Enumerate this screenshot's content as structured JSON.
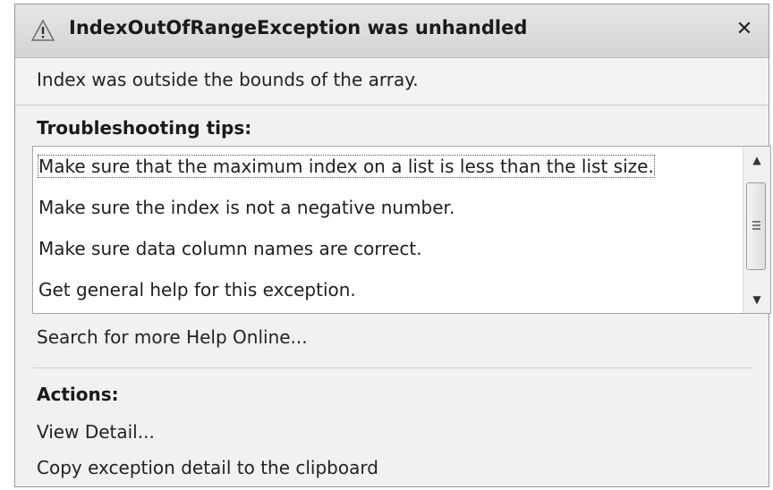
{
  "dialog": {
    "title": "IndexOutOfRangeException was unhandled",
    "close_symbol": "✕",
    "message": "Index was outside the bounds of the array."
  },
  "troubleshooting": {
    "heading": "Troubleshooting tips:",
    "tips": [
      "Make sure that the maximum index on a list is less than the list size.",
      "Make sure the index is not a negative number.",
      "Make sure data column names are correct.",
      "Get general help for this exception."
    ]
  },
  "search_online": "Search for more Help Online...",
  "actions": {
    "heading": "Actions:",
    "items": [
      "View Detail...",
      "Copy exception detail to the clipboard"
    ]
  },
  "icons": {
    "title_icon": "warning-triangle-icon",
    "scroll_up": "scroll-up-arrow-icon",
    "scroll_down": "scroll-down-arrow-icon"
  },
  "colors": {
    "titlebar": "#dcdcdc",
    "body": "#f1f1f1",
    "list_background": "#ffffff"
  }
}
